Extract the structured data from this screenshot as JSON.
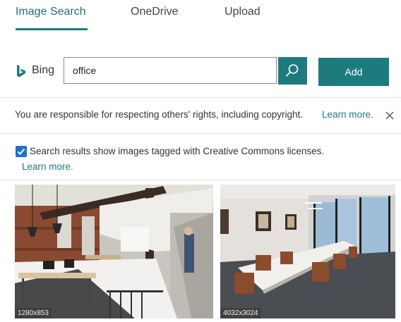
{
  "tabs": [
    {
      "label": "Image Search"
    },
    {
      "label": "OneDrive"
    },
    {
      "label": "Upload"
    }
  ],
  "search": {
    "provider": "Bing",
    "query": "office",
    "add_label": "Add"
  },
  "notice": {
    "text": "You are responsible for respecting others' rights, including copyright.",
    "link": "Learn more."
  },
  "creative_commons": {
    "checked": true,
    "text": "Search results show images tagged with Creative Commons licenses.",
    "link": "Learn more."
  },
  "results": [
    {
      "dimensions": "1280x853"
    },
    {
      "dimensions": "4032x3024"
    }
  ],
  "colors": {
    "accent": "#1e7b7d",
    "checkbox": "#1a73c7"
  }
}
